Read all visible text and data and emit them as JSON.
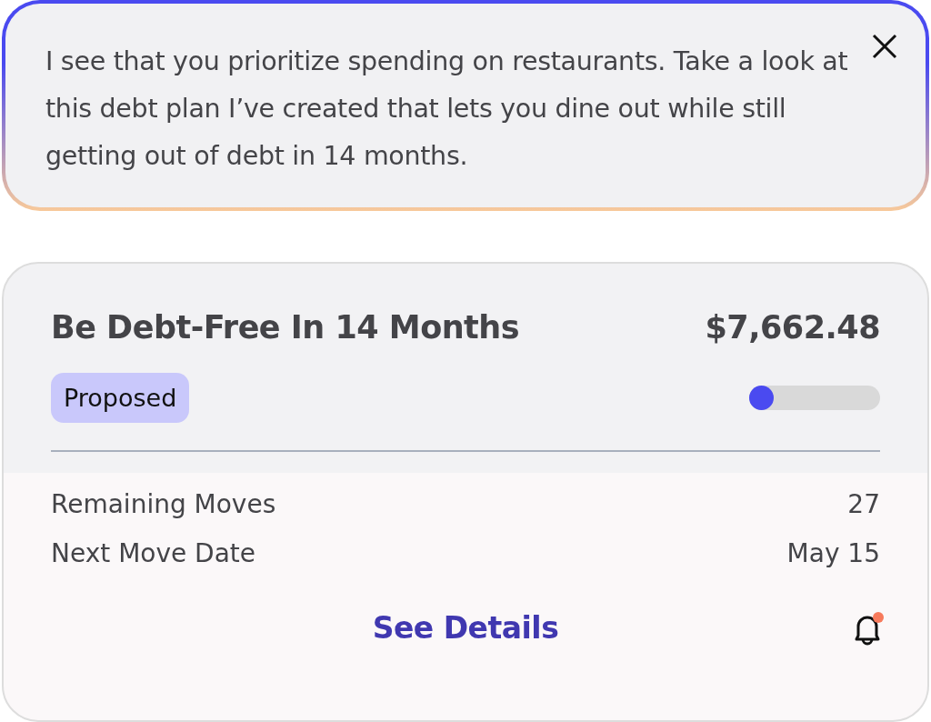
{
  "message": {
    "text": "I see that you prioritize spending on restaurants. Take a look at this debt plan I’ve created that lets you dine out while still getting out of debt in 14 months."
  },
  "plan": {
    "title": "Be Debt-Free In 14 Months",
    "amount": "$7,662.48",
    "status": "Proposed",
    "progress": {
      "level": 0.04
    },
    "details": [
      {
        "label": "Remaining Moves",
        "value": "27"
      },
      {
        "label": "Next Move Date",
        "value": "May 15"
      }
    ],
    "link": "See Details",
    "notification": true
  }
}
